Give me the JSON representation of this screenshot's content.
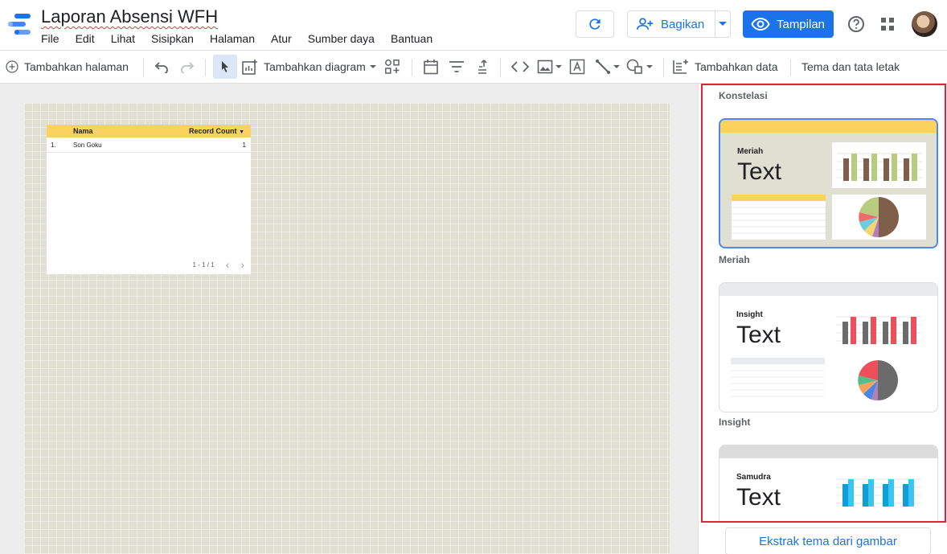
{
  "header": {
    "title": "Laporan Absensi WFH",
    "menu": [
      "File",
      "Edit",
      "Lihat",
      "Sisipkan",
      "Halaman",
      "Atur",
      "Sumber daya",
      "Bantuan"
    ],
    "share_label": "Bagikan",
    "view_label": "Tampilan"
  },
  "toolbar": {
    "add_page": "Tambahkan halaman",
    "add_chart": "Tambahkan diagram",
    "add_data": "Tambahkan data",
    "theme_layout": "Tema dan tata letak"
  },
  "table_widget": {
    "columns": [
      "Nama",
      "Record Count"
    ],
    "rows": [
      {
        "index": "1.",
        "name": "Son Goku",
        "count": "1"
      }
    ],
    "pager": "1 - 1 / 1",
    "header_color": "#fcd25e"
  },
  "themes": {
    "section_label": "Konstelasi",
    "items": [
      {
        "name": "Meriah",
        "sample_title": "Meriah",
        "sample_text": "Text",
        "bar_color": "#fcd25e",
        "bg_color": "#dfdfd2"
      },
      {
        "name": "Insight",
        "sample_title": "Insight",
        "sample_text": "Text",
        "bar_color": "#e8eaed",
        "bg_color": "#ffffff"
      },
      {
        "name": "Samudra",
        "sample_title": "Samudra",
        "sample_text": "Text",
        "bar_color": "#dcdcdc",
        "bg_color": "#ffffff"
      }
    ],
    "extract_button": "Ekstrak tema dari gambar"
  },
  "colors": {
    "accent": "#1a73e8",
    "highlight_border": "#e8203a"
  }
}
